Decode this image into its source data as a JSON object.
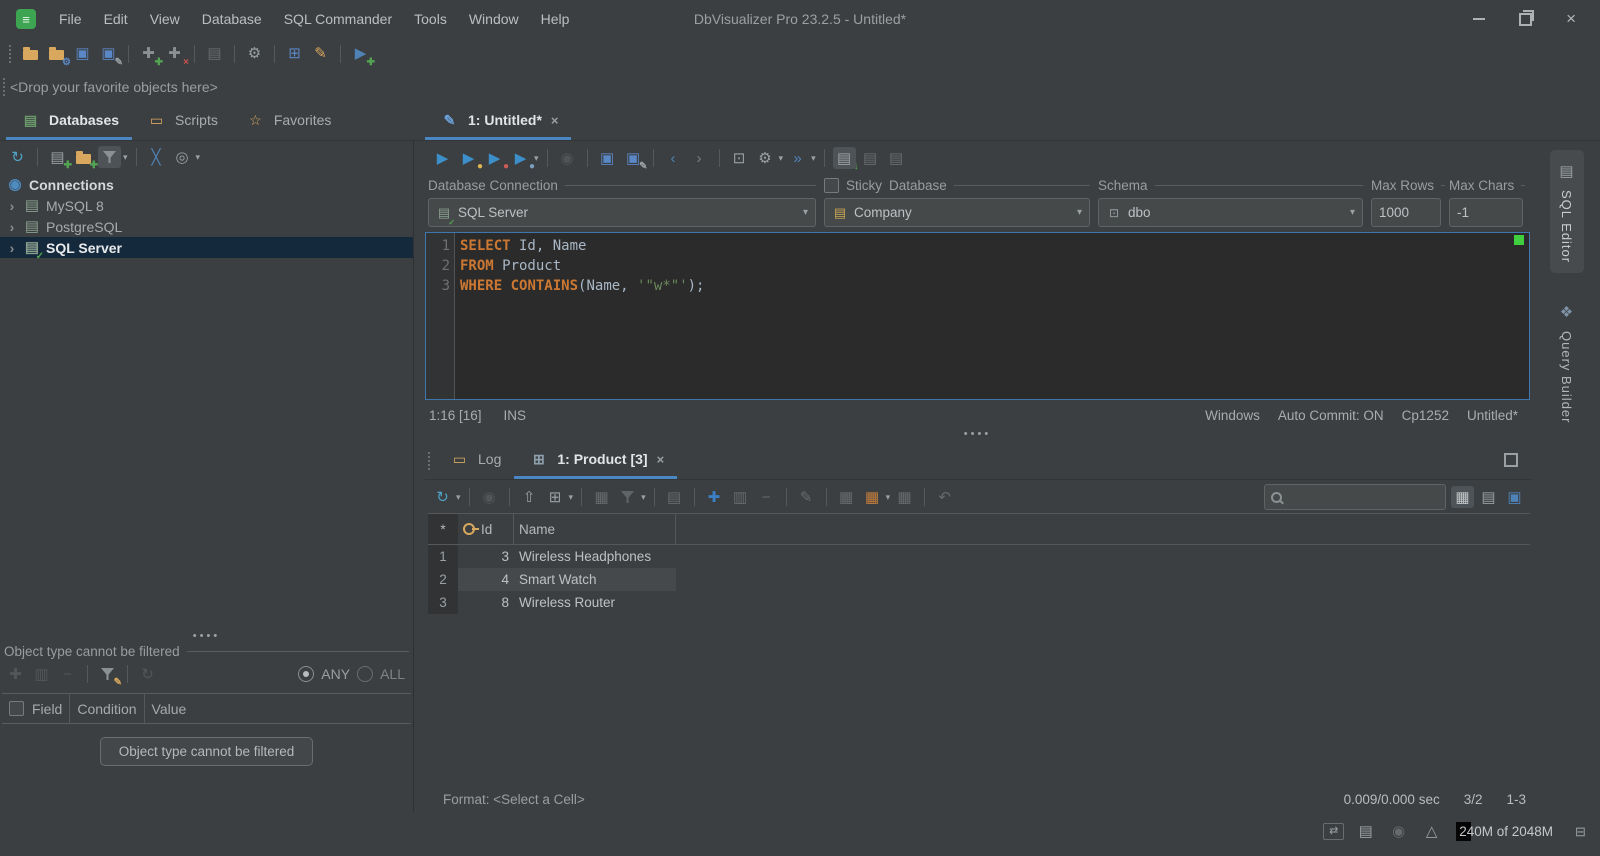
{
  "window": {
    "title": "DbVisualizer Pro 23.2.5 - Untitled*",
    "menus": [
      "File",
      "Edit",
      "View",
      "Database",
      "SQL Commander",
      "Tools",
      "Window",
      "Help"
    ]
  },
  "favorites_bar": {
    "text": "<Drop your favorite objects here>"
  },
  "sidebar": {
    "tabs": [
      {
        "label": "Databases",
        "icon": {
          "n": "databases-tab-icon",
          "g": "▤",
          "c": "#6a9a6a"
        },
        "active": true
      },
      {
        "label": "Scripts",
        "icon": {
          "n": "scripts-tab-icon",
          "g": "▭",
          "c": "#d7a85e"
        },
        "active": false
      },
      {
        "label": "Favorites",
        "icon": {
          "n": "favorites-tab-icon",
          "g": "☆",
          "c": "#d7a85e"
        },
        "active": false
      }
    ],
    "tree": {
      "root": {
        "label": "Connections",
        "icon": {
          "n": "connections-globe-icon",
          "g": "◉",
          "c": "#4e8cc2"
        }
      },
      "items": [
        {
          "label": "MySQL 8",
          "selected": false
        },
        {
          "label": "PostgreSQL",
          "selected": false
        },
        {
          "label": "SQL Server",
          "selected": true
        }
      ]
    },
    "filter_panel": {
      "header": "Object type cannot be filtered",
      "radio_any": "ANY",
      "radio_all": "ALL",
      "columns": [
        "Field",
        "Condition",
        "Value"
      ],
      "button_label": "Object type cannot be filtered"
    }
  },
  "editor": {
    "tab_label": "1: Untitled*",
    "connection_label": "Database Connection",
    "connection_value": "SQL Server",
    "sticky_label": "Sticky",
    "database_label": "Database",
    "database_value": "Company",
    "schema_label": "Schema",
    "schema_value": "dbo",
    "max_rows_label": "Max Rows",
    "max_rows_value": "1000",
    "max_chars_label": "Max Chars",
    "max_chars_value": "-1",
    "code_lines": [
      {
        "num": "1",
        "tokens": [
          [
            "kw",
            "SELECT"
          ],
          [
            "pl",
            " Id, Name"
          ]
        ]
      },
      {
        "num": "2",
        "tokens": [
          [
            "kw",
            "FROM"
          ],
          [
            "pl",
            " Product"
          ]
        ]
      },
      {
        "num": "3",
        "tokens": [
          [
            "kw",
            "WHERE"
          ],
          [
            "pl",
            " "
          ],
          [
            "kw",
            "CONTAINS"
          ],
          [
            "pl",
            "(Name, "
          ],
          [
            "str",
            "'\"w*\"'"
          ],
          [
            "pl",
            ");"
          ]
        ]
      }
    ],
    "status_left": [
      "1:16 [16]",
      "INS"
    ],
    "status_right": [
      "Windows",
      "Auto Commit: ON",
      "Cp1252",
      "Untitled*"
    ]
  },
  "results": {
    "tabs": [
      {
        "label": "Log",
        "icon": {
          "n": "log-tab-icon",
          "g": "▭",
          "c": "#d7a85e"
        },
        "active": false,
        "closable": false
      },
      {
        "label": "1: Product [3]",
        "icon": {
          "n": "result-grid-tab-icon",
          "g": "⊞",
          "c": "#8fa0ad"
        },
        "active": true,
        "closable": true
      }
    ],
    "grid": {
      "corner": "*",
      "columns": [
        "Id",
        "Name"
      ],
      "rows": [
        {
          "n": "1",
          "id": "3",
          "name": "Wireless Headphones"
        },
        {
          "n": "2",
          "id": "4",
          "name": "Smart Watch"
        },
        {
          "n": "3",
          "id": "8",
          "name": "Wireless Router"
        }
      ]
    },
    "status_left": "Format: <Select a Cell>",
    "timing": "0.009/0.000 sec",
    "rows_cols": "3/2",
    "range": "1-3"
  },
  "right_tabs": [
    {
      "label": "SQL Editor",
      "icon": {
        "n": "sql-editor-tab-icon",
        "g": "▤",
        "c": "#9aa0a3"
      },
      "active": true
    },
    {
      "label": "Query Builder",
      "icon": {
        "n": "query-builder-tab-icon",
        "g": "❖",
        "c": "#7f93a8"
      },
      "active": false
    }
  ],
  "statusbar": {
    "memory": "240M of 2048M"
  },
  "toolbars": {
    "main": [
      {
        "n": "open-file-icon",
        "g": "folder"
      },
      {
        "n": "open-recent-icon",
        "g": "folder",
        "badge": {
          "g": "⚙",
          "c": "#5a87c5"
        }
      },
      {
        "n": "save-icon",
        "g": "▣",
        "c": "#5a87c5"
      },
      {
        "n": "save-as-icon",
        "g": "▣",
        "c": "#5a87c5",
        "badge": {
          "g": "✎",
          "c": "#9aa0a3"
        }
      },
      {
        "sep": true
      },
      {
        "n": "connect-icon",
        "g": "✚",
        "c": "#8b9193",
        "badge": {
          "g": "✚",
          "c": "#52a552"
        }
      },
      {
        "n": "disconnect-icon",
        "g": "✚",
        "c": "#8b9193",
        "badge": {
          "g": "×",
          "c": "#c75450"
        }
      },
      {
        "sep": true
      },
      {
        "n": "commit-icon",
        "g": "▤",
        "c": "#9aa0a3",
        "dim": true
      },
      {
        "sep": true
      },
      {
        "n": "tool-properties-icon",
        "g": "⚙",
        "c": "#9aa0a3"
      },
      {
        "sep": true
      },
      {
        "n": "table-data-icon",
        "g": "⊞",
        "c": "#5a87c5"
      },
      {
        "n": "sql-commander-icon",
        "g": "✎",
        "c": "#d7a85e"
      },
      {
        "sep": true
      },
      {
        "n": "new-bookmark-icon",
        "g": "▶",
        "c": "#4f83b8",
        "badge": {
          "g": "✚",
          "c": "#52a552"
        }
      }
    ],
    "sidebar": [
      {
        "n": "refresh-objects-icon",
        "g": "↻",
        "c": "#4fa3c7"
      },
      {
        "sep": true
      },
      {
        "n": "create-connection-icon",
        "g": "▤",
        "c": "#9aa0a3",
        "badge": {
          "g": "✚",
          "c": "#52a552"
        }
      },
      {
        "n": "create-folder-icon",
        "g": "folder",
        "badge": {
          "g": "✚",
          "c": "#52a552"
        }
      },
      {
        "n": "filter-objects-icon",
        "g": "funnel",
        "boxed": true,
        "chev": true
      },
      {
        "sep": true
      },
      {
        "n": "collapse-all-icon",
        "g": "╳",
        "c": "#4f83b8"
      },
      {
        "n": "locate-object-icon",
        "g": "◎",
        "c": "#9aa0a3",
        "chev": true
      }
    ],
    "editor": [
      {
        "n": "execute-icon",
        "g": "▶",
        "c": "#3d8fc9"
      },
      {
        "n": "execute-current-icon",
        "g": "▶",
        "c": "#3d8fc9",
        "badge": {
          "g": "●",
          "c": "#e0b64f"
        }
      },
      {
        "n": "execute-buffer-icon",
        "g": "▶",
        "c": "#3d8fc9",
        "badge": {
          "g": "●",
          "c": "#cf5b56"
        }
      },
      {
        "n": "execute-explain-icon",
        "g": "▶",
        "c": "#3d8fc9",
        "badge": {
          "g": "●",
          "c": "#7b9fc0"
        },
        "chev": true
      },
      {
        "sep": true
      },
      {
        "n": "stop-icon",
        "g": "◉",
        "c": "#6e7173",
        "dim": true
      },
      {
        "sep": true
      },
      {
        "n": "save-editor-icon",
        "g": "▣",
        "c": "#5a87c5"
      },
      {
        "n": "save-as-editor-icon",
        "g": "▣",
        "c": "#5a87c5",
        "badge": {
          "g": "✎",
          "c": "#9aa0a3"
        }
      },
      {
        "sep": true
      },
      {
        "n": "back-icon",
        "g": "‹",
        "c": "#4f83b8"
      },
      {
        "n": "forward-icon",
        "g": "›",
        "c": "#7b7e80"
      },
      {
        "sep": true
      },
      {
        "n": "visualize-query-icon",
        "g": "⊡",
        "c": "#9aa0a3"
      },
      {
        "n": "editor-tools-icon",
        "g": "⚙",
        "c": "#9aa0a3",
        "chev": true
      },
      {
        "n": "goto-next-icon",
        "g": "»",
        "c": "#4f83b8",
        "chev": true
      },
      {
        "sep": true
      },
      {
        "n": "auto-commit-icon",
        "g": "▤",
        "c": "#9aa0a3",
        "boxed": true,
        "badge": {
          "g": "↓",
          "c": "#52a552"
        }
      },
      {
        "n": "commit-tx-icon",
        "g": "▤",
        "c": "#9aa0a3",
        "dim": true
      },
      {
        "n": "rollback-tx-icon",
        "g": "▤",
        "c": "#9aa0a3",
        "dim": true
      }
    ],
    "results": [
      {
        "n": "rerun-icon",
        "g": "↻",
        "c": "#4fa3c7",
        "chev": true
      },
      {
        "sep": true
      },
      {
        "n": "stop-result-icon",
        "g": "◉",
        "c": "#6e7173",
        "dim": true
      },
      {
        "sep": true
      },
      {
        "n": "export-grid-icon",
        "g": "⇧",
        "c": "#9aa0a3"
      },
      {
        "n": "grid-mode-icon",
        "g": "⊞",
        "c": "#9aa0a3",
        "chev": true
      },
      {
        "sep": true
      },
      {
        "n": "calculate-icon",
        "g": "▦",
        "c": "#9aa0a3",
        "dim": true
      },
      {
        "n": "filter-result-icon",
        "g": "funnel",
        "dim": true,
        "chev": true
      },
      {
        "sep": true
      },
      {
        "n": "rowid-icon",
        "g": "▤",
        "c": "#9aa0a3",
        "dim": true
      },
      {
        "sep": true
      },
      {
        "n": "insert-row-icon",
        "g": "✚",
        "c": "#3b7fc4"
      },
      {
        "n": "duplicate-row-icon",
        "g": "▥",
        "c": "#9aa0a3",
        "dim": true
      },
      {
        "n": "delete-row-icon",
        "g": "−",
        "c": "#9aa0a3",
        "dim": true
      },
      {
        "sep": true
      },
      {
        "n": "edit-cell-icon",
        "g": "✎",
        "c": "#9aa0a3",
        "dim": true
      },
      {
        "sep": true
      },
      {
        "n": "grid-settings-icon",
        "g": "▦",
        "c": "#9aa0a3",
        "dim": true
      },
      {
        "n": "grid-highlight-icon",
        "g": "▦",
        "c": "#c77f3c",
        "chev": true
      },
      {
        "n": "grid-compare-icon",
        "g": "▦",
        "c": "#9aa0a3",
        "dim": true
      },
      {
        "sep": true
      },
      {
        "n": "undo-icon",
        "g": "↶",
        "c": "#9aa0a3",
        "dim": true
      }
    ],
    "filter": [
      {
        "n": "add-filter-icon",
        "g": "✚",
        "c": "#6f7274",
        "dim": true
      },
      {
        "n": "copy-filter-icon",
        "g": "▥",
        "c": "#6f7274",
        "dim": true
      },
      {
        "n": "remove-filter-icon",
        "g": "−",
        "c": "#6f7274",
        "dim": true
      },
      {
        "sep": true
      },
      {
        "n": "edit-filter-icon",
        "g": "funnel",
        "badge": {
          "g": "✎",
          "c": "#d7a85e"
        }
      },
      {
        "sep": true
      },
      {
        "n": "refresh-filter-icon",
        "g": "↻",
        "c": "#6f7274",
        "dim": true
      }
    ],
    "view_toggles": [
      {
        "n": "grid-view-icon",
        "g": "▦",
        "c": "#c5c8ca",
        "boxed": true
      },
      {
        "n": "form-view-icon",
        "g": "▤",
        "c": "#9aa0a3"
      },
      {
        "n": "text-view-icon",
        "g": "▣",
        "c": "#4f83b8"
      }
    ],
    "statusbar": [
      {
        "n": "connection-monitor-icon",
        "g": "⇄",
        "c": "#9aa0a3",
        "framed": true
      },
      {
        "n": "database-status-icon",
        "g": "▤",
        "c": "#9aa0a3"
      },
      {
        "n": "driver-status-icon",
        "g": "◉",
        "c": "#9aa0a3",
        "dim": true
      },
      {
        "n": "warning-icon",
        "g": "△",
        "c": "#9aa0a3"
      }
    ]
  }
}
